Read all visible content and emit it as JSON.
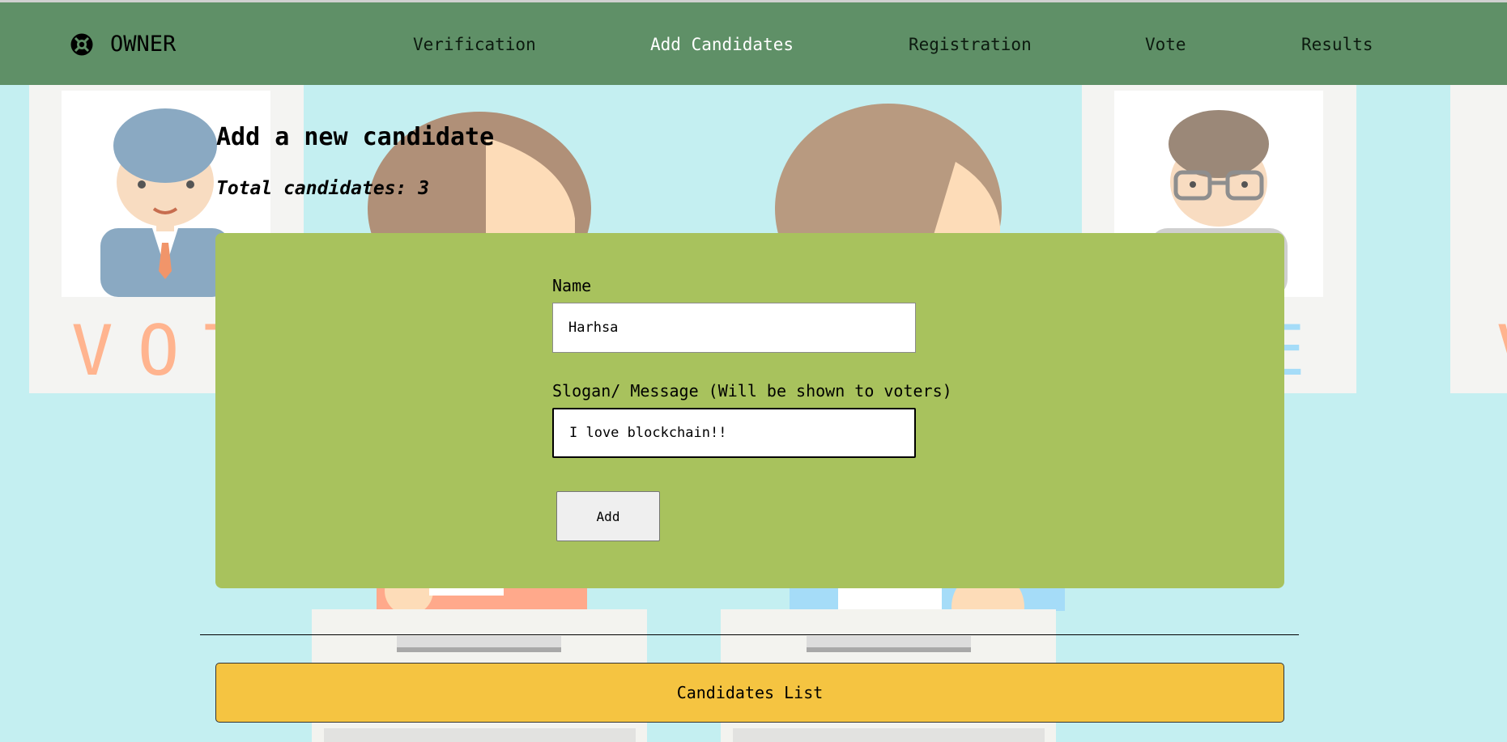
{
  "brand": {
    "name": "OWNER",
    "icon": "lifebuoy-icon"
  },
  "nav": {
    "items": [
      {
        "label": "Verification",
        "active": false
      },
      {
        "label": "Add Candidates",
        "active": true
      },
      {
        "label": "Registration",
        "active": false
      },
      {
        "label": "Vote",
        "active": false
      },
      {
        "label": "Results",
        "active": false
      }
    ]
  },
  "background": {
    "poster_text": "VOTE"
  },
  "main": {
    "title": "Add a new candidate",
    "total_candidates": "Total candidates: 3"
  },
  "form": {
    "name_label": "Name",
    "name_value": "Harhsa",
    "slogan_label": "Slogan/ Message (Will be shown to voters)",
    "slogan_value": "I love blockchain!!",
    "add_label": "Add"
  },
  "candidates_list_label": "Candidates List",
  "colors": {
    "navbar": "#5f9067",
    "background": "#c4eff1",
    "form_panel": "#a8c25d",
    "list_button": "#f5c441"
  }
}
